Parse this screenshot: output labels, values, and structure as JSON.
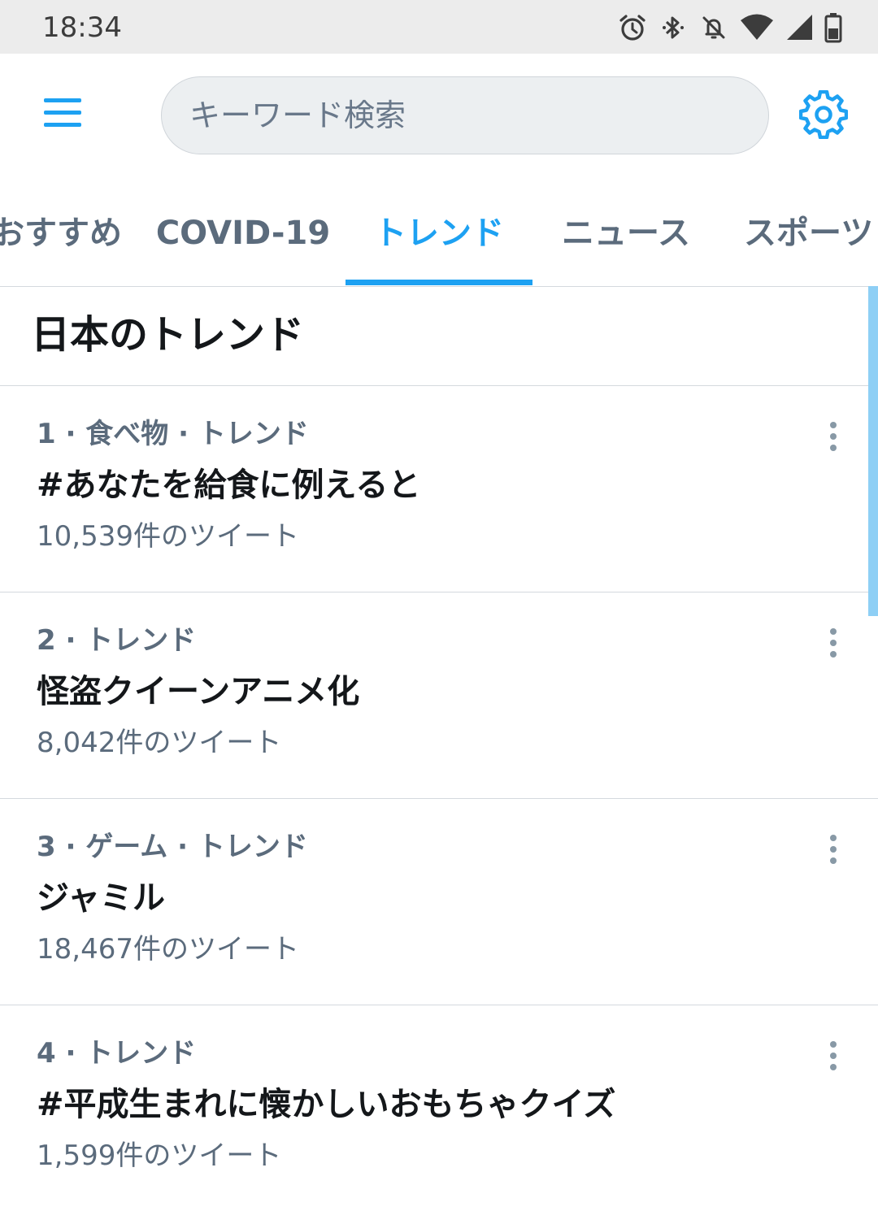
{
  "status_bar": {
    "time": "18:34",
    "icons": [
      "alarm-icon",
      "bluetooth-icon",
      "notifications-off-icon",
      "wifi-icon",
      "cellular-icon",
      "battery-icon"
    ]
  },
  "app_bar": {
    "search": {
      "placeholder": "キーワード検索",
      "value": ""
    },
    "icons": [
      "menu-icon",
      "settings-gear-icon"
    ]
  },
  "tabs": [
    {
      "label": "おすすめ",
      "active": false
    },
    {
      "label": "COVID-19",
      "active": false
    },
    {
      "label": "トレンド",
      "active": true
    },
    {
      "label": "ニュース",
      "active": false
    },
    {
      "label": "スポーツ",
      "active": false
    }
  ],
  "section": {
    "title": "日本のトレンド"
  },
  "trends": [
    {
      "meta": "1 · 食べ物 · トレンド",
      "name": "#あなたを給食に例えると",
      "count": "10,539件のツイート"
    },
    {
      "meta": "2 · トレンド",
      "name": "怪盗クイーンアニメ化",
      "count": "8,042件のツイート"
    },
    {
      "meta": "3 · ゲーム · トレンド",
      "name": "ジャミル",
      "count": "18,467件のツイート"
    },
    {
      "meta": "4 · トレンド",
      "name": "#平成生まれに懐かしいおもちゃクイズ",
      "count": "1,599件のツイート"
    }
  ],
  "colors": {
    "accent": "#1da1f2",
    "secondary_text": "#5b6b7c",
    "primary_text": "#14171a",
    "status_bar_bg": "#ececec"
  }
}
